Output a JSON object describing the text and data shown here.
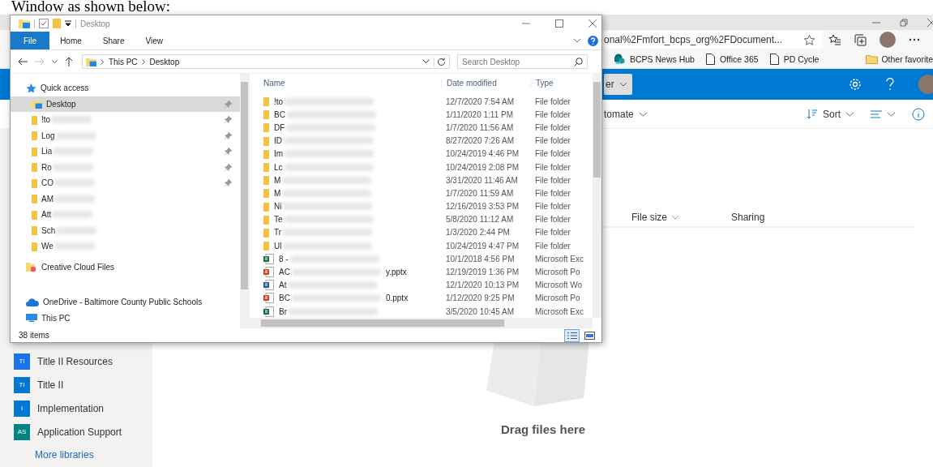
{
  "caption": "Window as shown below:",
  "browser": {
    "address": "onal%2Fmfort_bcps_org%2FDocument...",
    "favorites": [
      {
        "label": "BCPS News Hub",
        "kind": "sharepoint"
      },
      {
        "label": "Office 365",
        "kind": "page"
      },
      {
        "label": "PD Cycle",
        "kind": "page"
      }
    ],
    "other_favorites": "Other favorite",
    "header_button": "er",
    "automate": "tomate",
    "sort": "Sort",
    "columns": [
      "File size",
      "Sharing"
    ],
    "libraries": [
      {
        "badge": "TI",
        "label": "Title II Resources",
        "color": "#1a73e8"
      },
      {
        "badge": "TI",
        "label": "Title II",
        "color": "#0078d4"
      },
      {
        "badge": "I",
        "label": "Implementation",
        "color": "#0078d4"
      },
      {
        "badge": "AS",
        "label": "Application Support",
        "color": "#038387"
      }
    ],
    "more_libraries": "More libraries",
    "empty_state": "Drag files here"
  },
  "explorer": {
    "title": "Desktop",
    "ribbon_tabs": [
      {
        "label": "File",
        "selected": true
      },
      {
        "label": "Home",
        "selected": false
      },
      {
        "label": "Share",
        "selected": false
      },
      {
        "label": "View",
        "selected": false
      }
    ],
    "path": [
      "This PC",
      "Desktop"
    ],
    "search_placeholder": "Search Desktop",
    "nav": [
      {
        "label": "Quick access",
        "kind": "quick_access",
        "children": [
          {
            "label": "Desktop",
            "kind": "desktop",
            "pinned": true,
            "selected": true,
            "redacted": false
          },
          {
            "label": "!to",
            "kind": "folder",
            "pinned": true,
            "selected": false,
            "redacted": true
          },
          {
            "label": "Log",
            "kind": "folder",
            "pinned": true,
            "selected": false,
            "redacted": true
          },
          {
            "label": "Lia",
            "kind": "folder",
            "pinned": true,
            "selected": false,
            "redacted": true
          },
          {
            "label": "Ro",
            "kind": "folder",
            "pinned": true,
            "selected": false,
            "redacted": true
          },
          {
            "label": "CO",
            "kind": "folder",
            "pinned": true,
            "selected": false,
            "redacted": true
          },
          {
            "label": "AM",
            "kind": "folder",
            "pinned": false,
            "selected": false,
            "redacted": true
          },
          {
            "label": "Att",
            "kind": "folder",
            "pinned": false,
            "selected": false,
            "redacted": true
          },
          {
            "label": "Sch",
            "kind": "folder",
            "pinned": false,
            "selected": false,
            "redacted": true
          },
          {
            "label": "We",
            "kind": "folder",
            "pinned": false,
            "selected": false,
            "redacted": true
          }
        ]
      },
      {
        "label": "Creative Cloud Files",
        "kind": "creative_cloud"
      },
      {
        "label": "OneDrive - Baltimore County Public Schools",
        "kind": "onedrive"
      },
      {
        "label": "This PC",
        "kind": "this_pc"
      }
    ],
    "columns": [
      "Name",
      "Date modified",
      "Type"
    ],
    "files": [
      {
        "kind": "folder",
        "name": "!to",
        "date": "12/7/2020 7:54 AM",
        "type": "File folder"
      },
      {
        "kind": "folder",
        "name": "BC",
        "date": "1/11/2020 1:11 PM",
        "type": "File folder"
      },
      {
        "kind": "folder",
        "name": "DF",
        "date": "1/7/2020 11:56 AM",
        "type": "File folder"
      },
      {
        "kind": "folder",
        "name": "ID",
        "date": "8/27/2020 7:26 AM",
        "type": "File folder"
      },
      {
        "kind": "folder",
        "name": "Im",
        "date": "10/24/2019 4:46 PM",
        "type": "File folder"
      },
      {
        "kind": "folder",
        "name": "Lc",
        "date": "10/24/2019 2:08 PM",
        "type": "File folder"
      },
      {
        "kind": "folder",
        "name": "M",
        "date": "3/31/2020 11:46 AM",
        "type": "File folder"
      },
      {
        "kind": "folder",
        "name": "M",
        "date": "1/7/2020 11:59 AM",
        "type": "File folder"
      },
      {
        "kind": "folder",
        "name": "Ni",
        "date": "12/16/2019 3:53 PM",
        "type": "File folder"
      },
      {
        "kind": "folder",
        "name": "Te",
        "date": "5/8/2020 11:12 AM",
        "type": "File folder"
      },
      {
        "kind": "folder",
        "name": "Tr",
        "date": "1/3/2020 2:44 PM",
        "type": "File folder"
      },
      {
        "kind": "folder",
        "name": "Ul",
        "date": "10/24/2019 4:47 PM",
        "type": "File folder"
      },
      {
        "kind": "excel",
        "name": "8 -",
        "date": "10/1/2018 4:56 PM",
        "type": "Microsoft Exc"
      },
      {
        "kind": "powerpoint",
        "name": "AC",
        "name_end": "y.pptx",
        "date": "12/19/2019 1:36 PM",
        "type": "Microsoft Po"
      },
      {
        "kind": "word",
        "name": "At",
        "date": "12/1/2020 10:13 PM",
        "type": "Microsoft Wo"
      },
      {
        "kind": "powerpoint",
        "name": "BC",
        "name_end": "0.pptx",
        "date": "1/12/2020 9:25 PM",
        "type": "Microsoft Po"
      },
      {
        "kind": "excel",
        "name": "Br",
        "date": "3/5/2020 10:45 AM",
        "type": "Microsoft Exc"
      }
    ],
    "status": "38 items",
    "views": [
      {
        "kind": "details",
        "selected": true
      },
      {
        "kind": "large_icons",
        "selected": false
      }
    ]
  }
}
